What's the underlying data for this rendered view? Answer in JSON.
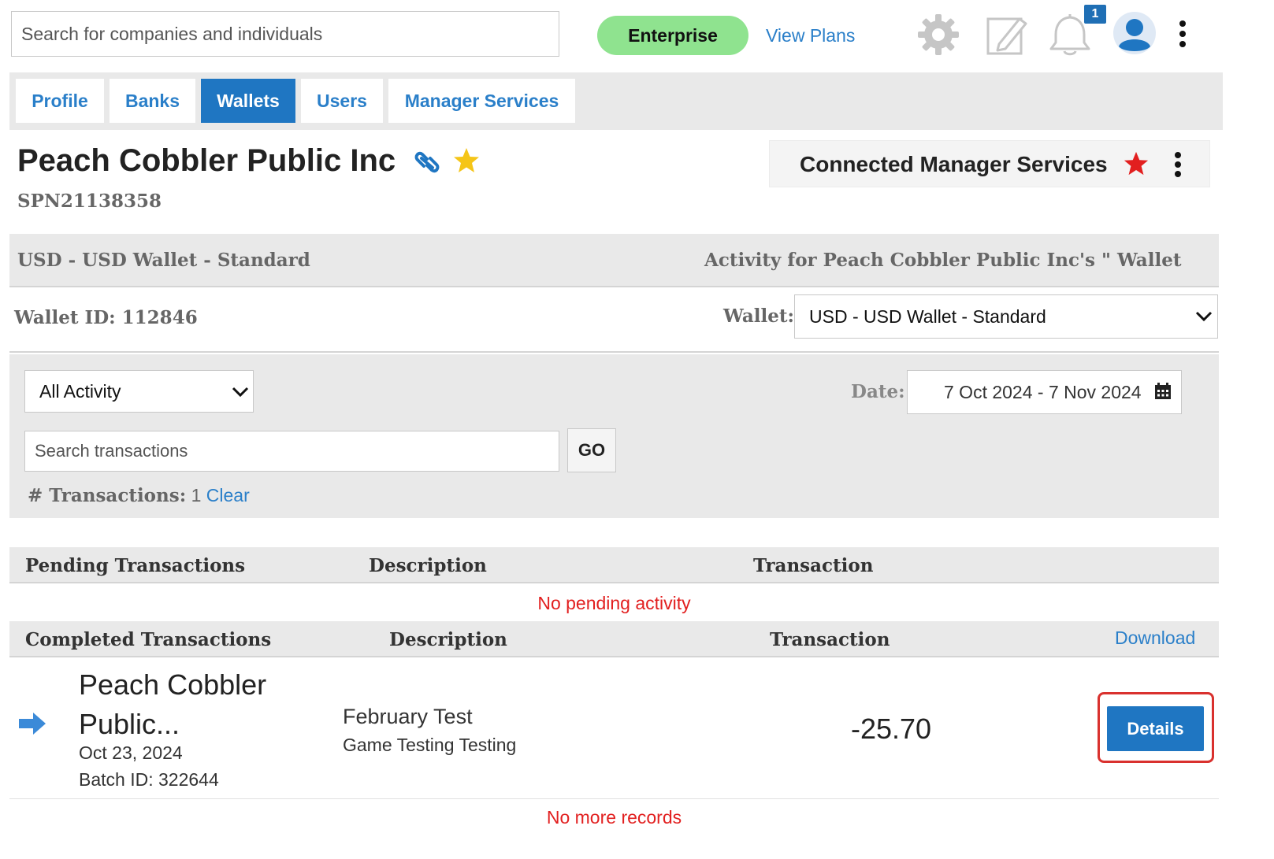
{
  "topbar": {
    "search_placeholder": "Search for companies and individuals",
    "plan_badge": "Enterprise",
    "view_plans": "View Plans",
    "notification_count": "1",
    "icons": [
      "gear-icon",
      "edit-note-icon",
      "bell-icon",
      "avatar-icon",
      "kebab-menu-icon"
    ]
  },
  "tabs": [
    {
      "label": "Profile",
      "active": false
    },
    {
      "label": "Banks",
      "active": false
    },
    {
      "label": "Wallets",
      "active": true
    },
    {
      "label": "Users",
      "active": false
    },
    {
      "label": "Manager Services",
      "active": false
    }
  ],
  "company": {
    "name": "Peach Cobbler Public Inc",
    "id": "SPN21138358",
    "connected_manager_services": "Connected Manager Services"
  },
  "wallet": {
    "name_heading": "USD - USD Wallet - Standard",
    "activity_heading": "Activity for Peach Cobbler Public Inc's \" Wallet",
    "id_label": "Wallet ID: 112846",
    "selector_label": "Wallet:",
    "selected": "USD - USD Wallet - Standard"
  },
  "filters": {
    "activity_type": "All Activity",
    "date_label": "Date:",
    "date_range": "7 Oct 2024 - 7 Nov 2024",
    "search_placeholder": "Search transactions",
    "go_label": "GO",
    "count_label": "# Transactions:",
    "count_value": "1",
    "clear_label": "Clear"
  },
  "pending": {
    "headers": [
      "Pending Transactions",
      "Description",
      "Transaction"
    ],
    "empty_message": "No pending activity"
  },
  "completed": {
    "headers": [
      "Completed Transactions",
      "Description",
      "Transaction"
    ],
    "download_label": "Download",
    "rows": [
      {
        "payee": "Peach Cobbler Public...",
        "date": "Oct 23, 2024",
        "batch": "Batch ID: 322644",
        "description": "February Test",
        "memo": "Game Testing Testing",
        "amount": "-25.70",
        "action": "Details"
      }
    ],
    "end_message": "No more records"
  },
  "colors": {
    "brand_blue": "#1f76c2",
    "link_blue": "#2a7fc9",
    "plan_green": "#8fe38f",
    "alert_red": "#e21f1f",
    "star_gold": "#f5c518"
  }
}
